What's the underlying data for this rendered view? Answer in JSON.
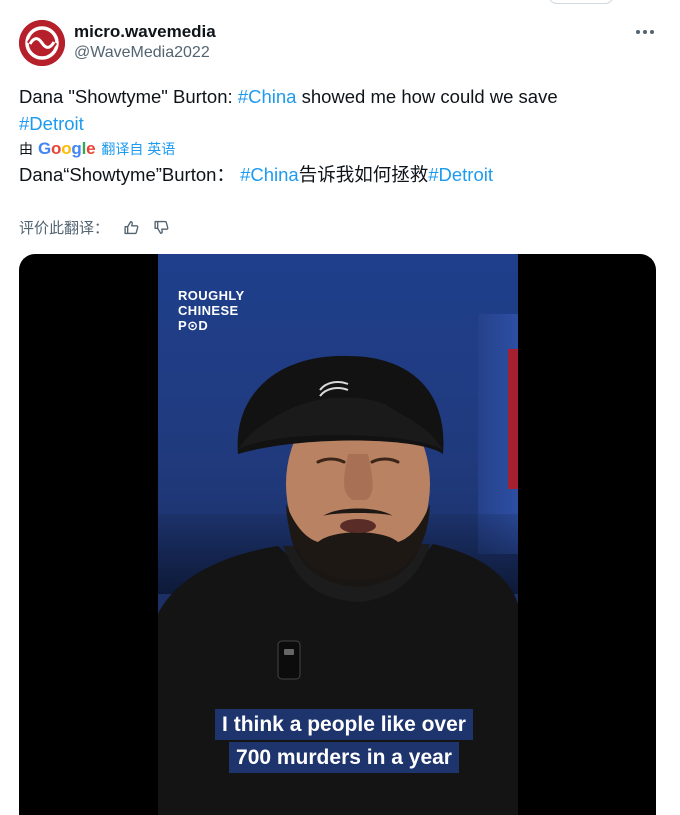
{
  "account": {
    "display_name": "micro.wavemedia",
    "handle": "@WaveMedia2022",
    "avatar_icon": "wave-logo-icon",
    "brand_color": "#b5202b"
  },
  "tweet": {
    "text_prefix": "Dana \"Showtyme\" Burton: ",
    "hashtag_1": "#China",
    "text_middle": " showed me how could we save",
    "hashtag_2": "#Detroit"
  },
  "translation": {
    "by_label": "由",
    "provider": [
      "G",
      "o",
      "o",
      "g",
      "l",
      "e"
    ],
    "link_label": "翻译自 英语",
    "text_prefix": "Dana“Showtyme”Burton：",
    "hashtag_1": "#China",
    "text_middle": "告诉我如何拯救",
    "hashtag_2": "#Detroit",
    "rate_label": "评价此翻译："
  },
  "media": {
    "watermark_line_1": "ROUGHLY",
    "watermark_line_2": "CHINESE",
    "watermark_line_3": "P⊙D",
    "cap_logo": "THE NORTH FACE",
    "caption_line_1": "I think a people like over",
    "caption_line_2": "700 murders in a year"
  },
  "colors": {
    "link": "#1d9bf0",
    "secondary_text": "#536471",
    "primary_text": "#0f1419"
  }
}
